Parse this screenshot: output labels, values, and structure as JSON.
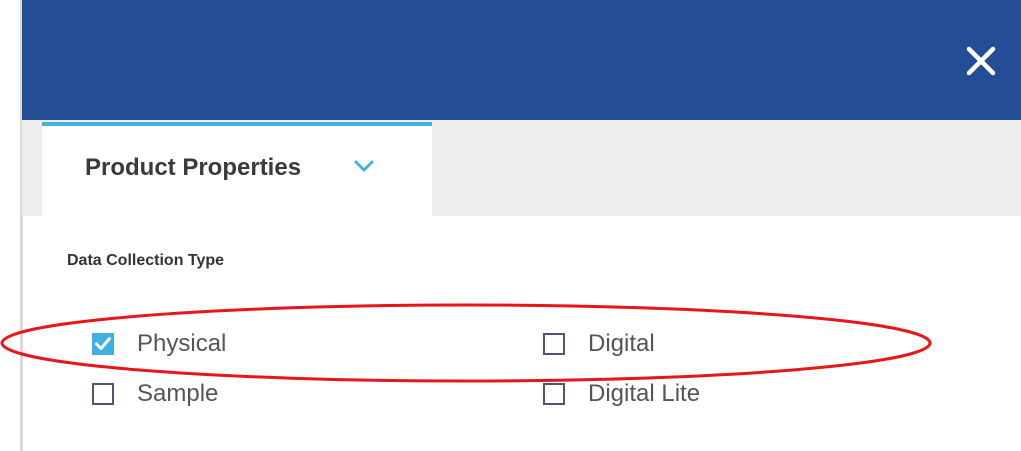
{
  "dialog": {
    "close_icon": "close-icon"
  },
  "tabs": [
    {
      "label": "Product Properties",
      "active": true,
      "icon": "chevron-down-icon"
    }
  ],
  "section": {
    "label": "Data Collection Type",
    "options": [
      {
        "label": "Physical",
        "checked": true
      },
      {
        "label": "Digital",
        "checked": false
      },
      {
        "label": "Sample",
        "checked": false
      },
      {
        "label": "Digital Lite",
        "checked": false
      }
    ]
  },
  "colors": {
    "header": "#234d94",
    "tab_accent": "#40b3de",
    "checkbox_checked": "#3fb0df",
    "annotation": "#e8161b"
  }
}
